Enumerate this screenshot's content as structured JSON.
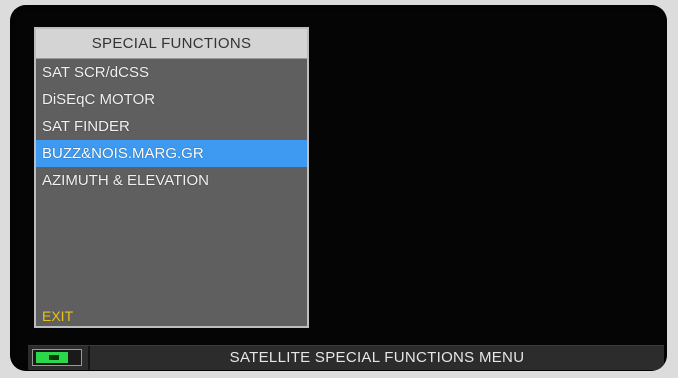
{
  "menu": {
    "title": "SPECIAL FUNCTIONS",
    "items": [
      {
        "label": "SAT SCR/dCSS"
      },
      {
        "label": "DiSEqC MOTOR"
      },
      {
        "label": "SAT FINDER"
      },
      {
        "label": "BUZZ&NOIS.MARG.GR",
        "selected": true
      },
      {
        "label": "AZIMUTH & ELEVATION"
      }
    ],
    "exit_label": "EXIT"
  },
  "status_bar": {
    "title": "SATELLITE SPECIAL FUNCTIONS MENU",
    "battery_icon": "battery-charging-icon"
  },
  "colors": {
    "selected_item": "#3d9af0",
    "exit_text": "#e8c21a",
    "battery_fill": "#2ad84a"
  }
}
